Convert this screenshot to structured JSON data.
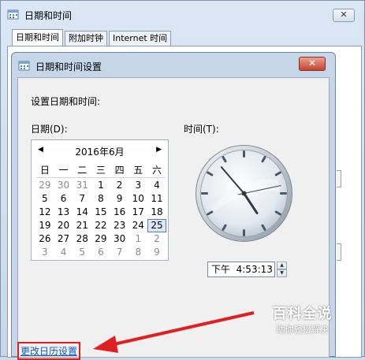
{
  "outer_window": {
    "title": "日期和时间",
    "close_glyph": "✕",
    "tabs": [
      {
        "label": "日期和时间",
        "active": true
      },
      {
        "label": "附加时钟",
        "active": false
      },
      {
        "label": "Internet 时间",
        "active": false
      }
    ]
  },
  "dialog": {
    "title": "日期和时间设置",
    "close_glyph": "✕",
    "heading": "设置日期和时间:",
    "date_label": "日期(D):",
    "time_label": "时间(T):",
    "change_calendar_link": "更改日历设置"
  },
  "calendar": {
    "month_title": "2016年6月",
    "prev_glyph": "◀",
    "next_glyph": "▶",
    "weekdays": [
      "日",
      "一",
      "二",
      "三",
      "四",
      "五",
      "六"
    ],
    "weeks": [
      [
        "29",
        "30",
        "31",
        "1",
        "2",
        "3",
        "4"
      ],
      [
        "5",
        "6",
        "7",
        "8",
        "9",
        "10",
        "11"
      ],
      [
        "12",
        "13",
        "14",
        "15",
        "16",
        "17",
        "18"
      ],
      [
        "19",
        "20",
        "21",
        "22",
        "23",
        "24",
        "25"
      ],
      [
        "26",
        "27",
        "28",
        "29",
        "30",
        "1",
        "2"
      ],
      [
        "3",
        "4",
        "5",
        "6",
        "7",
        "8",
        "9"
      ]
    ],
    "selected_day": "25"
  },
  "clock": {
    "hour": 4,
    "minute": 53,
    "second": 13
  },
  "time_field": {
    "value": "下午  4:53:13",
    "spin_up": "▲",
    "spin_down": "▼"
  },
  "watermark": {
    "main": "百科全说",
    "sub": "助你轻松解决"
  },
  "colors": {
    "link": "#0b5cc2",
    "highlight_box": "#e02020",
    "arrow": "#e02020"
  }
}
